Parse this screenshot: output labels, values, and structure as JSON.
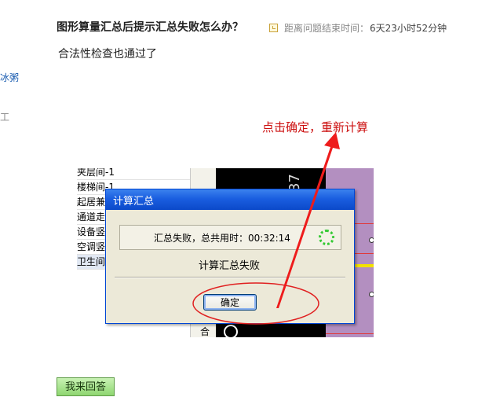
{
  "question": {
    "title": "图形算量汇总后提示汇总失败怎么办？",
    "timer_label": "距离问题结束时间：",
    "timer_value": "6天23小时52分钟",
    "body": "合法性检查也通过了"
  },
  "side_fragments": [
    "冰粥",
    "工"
  ],
  "annotation": {
    "text": "点击确定，重新计算"
  },
  "screenshot": {
    "tree_items": [
      "夹层间-1",
      "楼梯间-1",
      "起居兼",
      "通道走",
      "设备竖",
      "空调竖",
      "卫生间"
    ],
    "selected_index": 6,
    "cad_number": "37",
    "mid_bottom_char": "合"
  },
  "dialog": {
    "title": "计算汇总",
    "message": "汇总失败，总共用时：00:32:14",
    "status": "计算汇总失败",
    "ok_label": "确定"
  },
  "answer_button": {
    "label": "我来回答"
  },
  "colors": {
    "annotation": "#cc1010",
    "titlebar": "#1a5ee0",
    "dialog_bg": "#ece9d8",
    "answer_button": "#8ed670"
  }
}
